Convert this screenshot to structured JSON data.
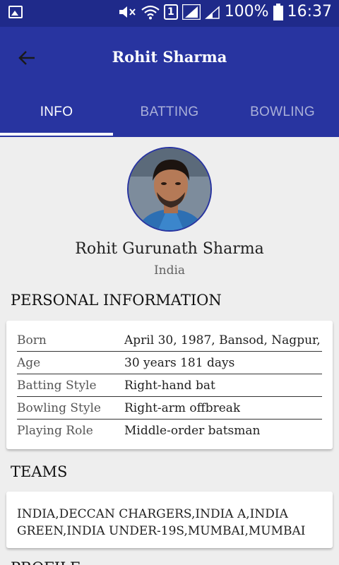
{
  "status_bar": {
    "battery": "100%",
    "time": "16:37",
    "sim": "1"
  },
  "app_bar": {
    "title": "Rohit Sharma"
  },
  "tabs": [
    {
      "label": "INFO",
      "active": true
    },
    {
      "label": "BATTING",
      "active": false
    },
    {
      "label": "BOWLING",
      "active": false
    }
  ],
  "player": {
    "full_name": "Rohit Gurunath Sharma",
    "country": "India"
  },
  "personal": {
    "section_title": "PERSONAL INFORMATION",
    "rows": [
      {
        "label": "Born",
        "value": "April 30, 1987, Bansod, Nagpur,"
      },
      {
        "label": "Age",
        "value": "30 years 181 days"
      },
      {
        "label": "Batting Style",
        "value": "Right-hand bat"
      },
      {
        "label": "Bowling Style",
        "value": "Right-arm offbreak"
      },
      {
        "label": "Playing Role",
        "value": "Middle-order batsman"
      }
    ]
  },
  "teams": {
    "section_title": "TEAMS",
    "text": "INDIA,DECCAN CHARGERS,INDIA A,INDIA GREEN,INDIA UNDER-19S,MUMBAI,MUMBAI"
  },
  "profile": {
    "section_title": "PROFILE"
  },
  "colors": {
    "primary": "#2834a0",
    "status_bar": "#1f2a8a",
    "background": "#eeeeee"
  }
}
